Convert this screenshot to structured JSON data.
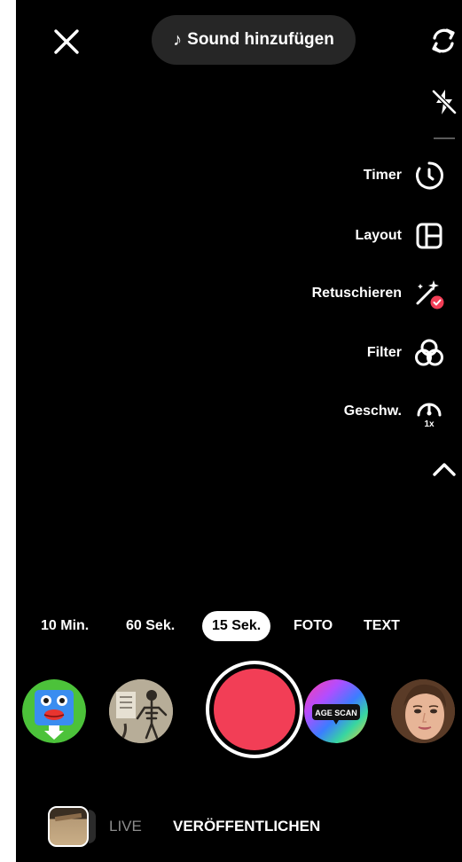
{
  "top_bar": {
    "sound_label": "Sound hinzufügen",
    "sound_icon": "music-note-icon",
    "close_icon": "close-icon",
    "flip_icon": "flip-camera-icon",
    "flash_icon": "flash-off-icon"
  },
  "tools": [
    {
      "label": "Timer",
      "icon": "timer-icon"
    },
    {
      "label": "Layout",
      "icon": "layout-icon"
    },
    {
      "label": "Retuschieren",
      "icon": "retouch-icon"
    },
    {
      "label": "Filter",
      "icon": "filter-icon"
    },
    {
      "label": "Geschw.",
      "icon": "speed-icon",
      "badge": "1x"
    }
  ],
  "collapse_icon": "chevron-up-icon",
  "modes": {
    "items": [
      "10 Min.",
      "60 Sek.",
      "15 Sek.",
      "FOTO",
      "TEXT"
    ],
    "selected": "15 Sek."
  },
  "effects": {
    "age_scan_label": "AGE SCAN"
  },
  "bottom_nav": {
    "live": "LIVE",
    "publish": "VERÖFFENTLICHEN"
  },
  "colors": {
    "background": "#000000",
    "record": "#f23e56",
    "sound_pill": "#262626",
    "inactive_tab": "#8d8d8d",
    "retouch_badge": "#f23e56"
  }
}
